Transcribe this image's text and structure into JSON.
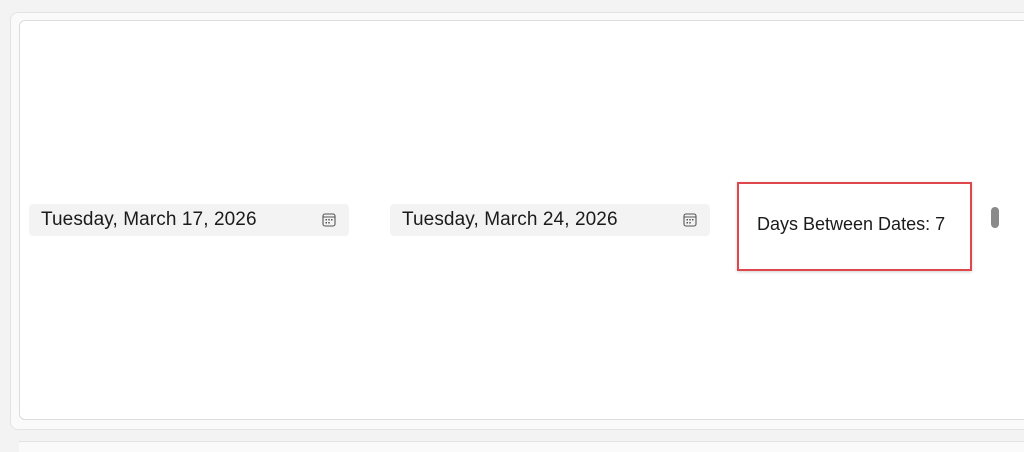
{
  "start_date": {
    "value": "Tuesday, March 17, 2026",
    "icon": "calendar-icon"
  },
  "end_date": {
    "value": "Tuesday, March 24, 2026",
    "icon": "calendar-icon"
  },
  "result": {
    "label": "Days Between Dates: 7",
    "highlight_color": "#e0474c"
  }
}
